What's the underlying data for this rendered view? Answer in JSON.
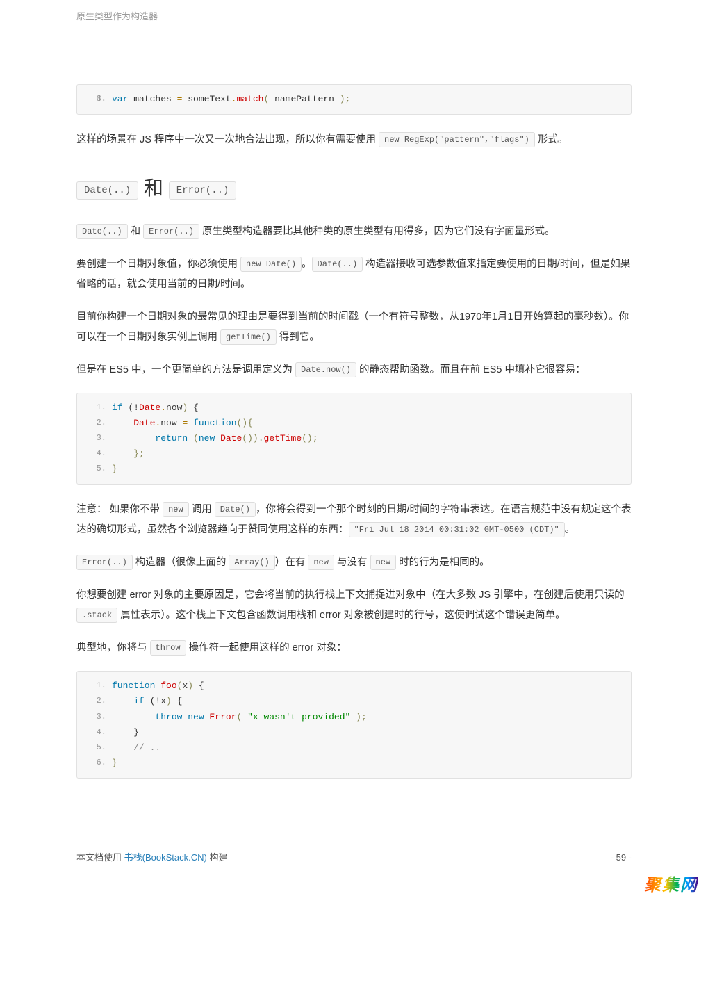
{
  "pageTitle": "原生类型作为构造器",
  "codeblock1": {
    "startLine": 3,
    "line1": "",
    "line2_a": "var",
    "line2_b": " matches ",
    "line2_c": "=",
    "line2_d": " someText",
    "line2_e": ".",
    "line2_f": "match",
    "line2_g": "(",
    "line2_h": " namePattern ",
    "line2_i": ");"
  },
  "p1_a": "这样的场景在 JS 程序中一次又一次地合法出现，所以你有需要使用 ",
  "p1_code1": "new RegExp(\"pattern\",\"flags\")",
  "p1_b": " 形式。",
  "section_c1": "Date(..)",
  "section_and": " 和 ",
  "section_c2": "Error(..)",
  "p2_c1": "Date(..)",
  "p2_a": " 和 ",
  "p2_c2": "Error(..)",
  "p2_b": " 原生类型构造器要比其他种类的原生类型有用得多，因为它们没有字面量形式。",
  "p3_a": "要创建一个日期对象值，你必须使用 ",
  "p3_c1": "new Date()",
  "p3_b": "。",
  "p3_c2": "Date(..)",
  "p3_c": " 构造器接收可选参数值来指定要使用的日期/时间，但是如果省略的话，就会使用当前的日期/时间。",
  "p4_a": "目前你构建一个日期对象的最常见的理由是要得到当前的时间戳（一个有符号整数，从1970年1月1日开始算起的毫秒数）。你可以在一个日期对象实例上调用 ",
  "p4_c1": "getTime()",
  "p4_b": " 得到它。",
  "p5_a": "但是在 ES5 中，一个更简单的方法是调用定义为 ",
  "p5_c1": "Date.now()",
  "p5_b": " 的静态帮助函数。而且在前 ES5 中填补它很容易：",
  "codeblock2": {
    "l1a": "if",
    "l1b": " (!",
    "l1c": "Date",
    "l1d": ".",
    "l1e": "now",
    "l1f": ")",
    "l1g": " {",
    "l2a": "    ",
    "l2b": "Date",
    "l2c": ".",
    "l2d": "now ",
    "l2e": "=",
    "l2f": " ",
    "l2g": "function",
    "l2h": "(){",
    "l3a": "        ",
    "l3b": "return",
    "l3c": " ",
    "l3d": "(",
    "l3e": "new",
    "l3f": " ",
    "l3g": "Date",
    "l3h": "()).",
    "l3i": "getTime",
    "l3j": "();",
    "l4a": "    ",
    "l4b": "};",
    "l5a": "}"
  },
  "p6_a": "注意： 如果你不带 ",
  "p6_c1": "new",
  "p6_b": " 调用 ",
  "p6_c2": "Date()",
  "p6_c": "，你将会得到一个那个时刻的日期/时间的字符串表达。在语言规范中没有规定这个表达的确切形式，虽然各个浏览器趋向于赞同使用这样的东西：",
  "p6_c3": "\"Fri Jul 18 2014 00:31:02 GMT-0500 (CDT)\"",
  "p6_d": "。",
  "p7_c1": "Error(..)",
  "p7_a": " 构造器（很像上面的 ",
  "p7_c2": "Array()",
  "p7_b": "）在有 ",
  "p7_c3": "new",
  "p7_c": " 与没有 ",
  "p7_c4": "new",
  "p7_d": " 时的行为是相同的。",
  "p8_a": "你想要创建 error 对象的主要原因是，它会将当前的执行栈上下文捕捉进对象中（在大多数 JS 引擎中，在创建后使用只读的 ",
  "p8_c1": ".stack",
  "p8_b": " 属性表示）。这个栈上下文包含函数调用栈和 error 对象被创建时的行号，这使调试这个错误更简单。",
  "p9_a": "典型地，你将与 ",
  "p9_c1": "throw",
  "p9_b": " 操作符一起使用这样的 error 对象：",
  "codeblock3": {
    "l1a": "function",
    "l1b": " ",
    "l1c": "foo",
    "l1d": "(",
    "l1e": "x",
    "l1f": ")",
    "l1g": " {",
    "l2a": "    ",
    "l2b": "if",
    "l2c": " (!",
    "l2d": "x",
    "l2e": ")",
    "l2f": " {",
    "l3a": "        ",
    "l3b": "throw",
    "l3c": " ",
    "l3d": "new",
    "l3e": " ",
    "l3f": "Error",
    "l3g": "(",
    "l3h": " ",
    "l3i": "\"x wasn't provided\"",
    "l3j": " ",
    "l3k": ");",
    "l4a": "    }",
    "l5a": "    ",
    "l5b": "// ..",
    "l6a": "}"
  },
  "footer": {
    "prefix": "本文档使用 ",
    "link": "书栈(BookStack.CN)",
    "suffix": " 构建",
    "page": "- 59 -"
  },
  "watermark": "聚集网"
}
